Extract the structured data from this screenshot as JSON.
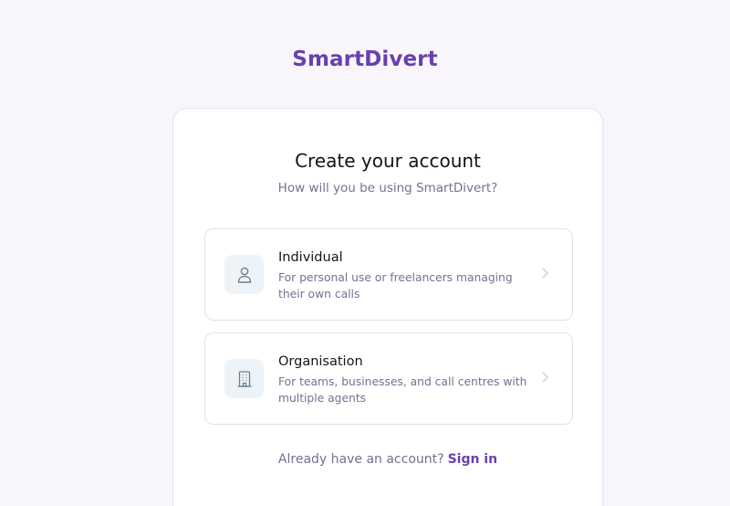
{
  "brand": {
    "name": "SmartDivert",
    "color": "#6b3fae"
  },
  "signup": {
    "title": "Create your account",
    "subtitle": "How will you be using SmartDivert?",
    "options": [
      {
        "title": "Individual",
        "description": "For personal use or freelancers managing their own calls",
        "icon": "person-icon"
      },
      {
        "title": "Organisation",
        "description": "For teams, businesses, and call centres with multiple agents",
        "icon": "building-icon"
      }
    ],
    "footer_text": "Already have an account?",
    "sign_in_label": "Sign in"
  }
}
